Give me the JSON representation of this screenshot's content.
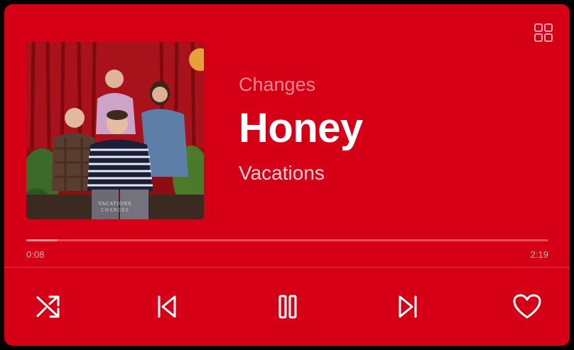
{
  "album": {
    "title": "Changes",
    "cover_band_text": "VACATIONS",
    "cover_album_text": "CHANGES"
  },
  "track": {
    "title": "Honey",
    "artist": "Vacations"
  },
  "progress": {
    "elapsed": "0:08",
    "total": "2:19",
    "fraction": 0.06
  },
  "controls": {
    "grid_icon": "grid-icon",
    "shuffle_icon": "shuffle-icon",
    "previous_icon": "skip-previous-icon",
    "pause_icon": "pause-icon",
    "next_icon": "skip-next-icon",
    "like_icon": "heart-icon"
  },
  "colors": {
    "background": "#D50016",
    "title": "#FFFFFF",
    "album_text": "#F28891",
    "artist_text": "#FAD3D6",
    "progress_track": "#E54E5B",
    "progress_fill": "#F48A93"
  }
}
